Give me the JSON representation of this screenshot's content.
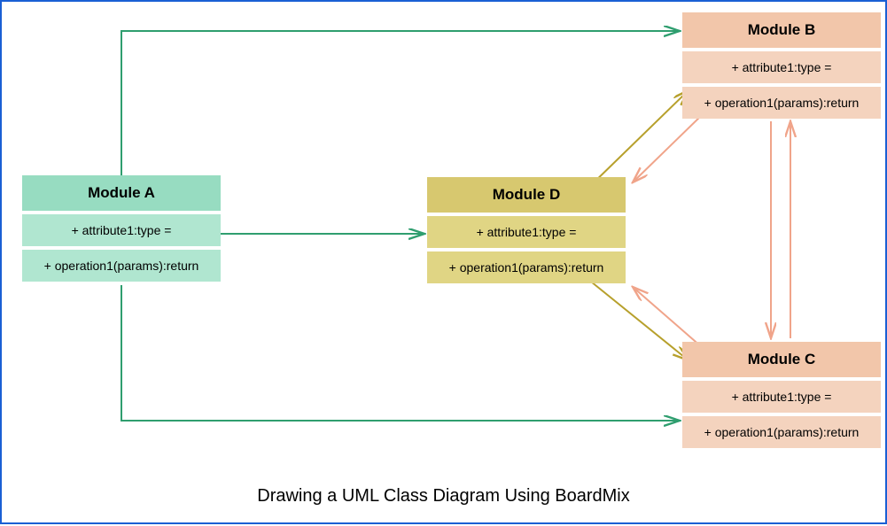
{
  "caption": "Drawing a UML Class Diagram Using BoardMix",
  "modules": {
    "a": {
      "name": "Module A",
      "attribute": "+ attribute1:type =",
      "operation": "+ operation1(params):return",
      "color_header": "#97dcc1",
      "color_row": "#b0e6d0"
    },
    "b": {
      "name": "Module B",
      "attribute": "+ attribute1:type =",
      "operation": "+ operation1(params):return",
      "color_header": "#f2c6aa",
      "color_row": "#f4d3be"
    },
    "c": {
      "name": "Module C",
      "attribute": "+ attribute1:type =",
      "operation": "+ operation1(params):return",
      "color_header": "#f2c6aa",
      "color_row": "#f4d3be"
    },
    "d": {
      "name": "Module D",
      "attribute": "+ attribute1:type =",
      "operation": "+ operation1(params):return",
      "color_header": "#d7c86f",
      "color_row": "#e0d584"
    }
  },
  "arrows": {
    "green": "#2f9e6f",
    "olive": "#b7a02c",
    "salmon": "#f0a48a"
  },
  "connections": [
    {
      "from": "A",
      "to": "B",
      "color": "green",
      "style": "orthogonal-top"
    },
    {
      "from": "A",
      "to": "D",
      "color": "green",
      "style": "straight"
    },
    {
      "from": "A",
      "to": "C",
      "color": "green",
      "style": "orthogonal-bottom"
    },
    {
      "from": "D",
      "to": "B",
      "color": "olive",
      "style": "diagonal"
    },
    {
      "from": "D",
      "to": "C",
      "color": "olive",
      "style": "diagonal"
    },
    {
      "from": "B",
      "to": "D",
      "color": "salmon",
      "style": "diagonal"
    },
    {
      "from": "C",
      "to": "D",
      "color": "salmon",
      "style": "diagonal"
    },
    {
      "from": "B",
      "to": "C",
      "color": "salmon",
      "style": "bidirectional"
    },
    {
      "from": "C",
      "to": "B",
      "color": "salmon",
      "style": "bidirectional"
    }
  ]
}
